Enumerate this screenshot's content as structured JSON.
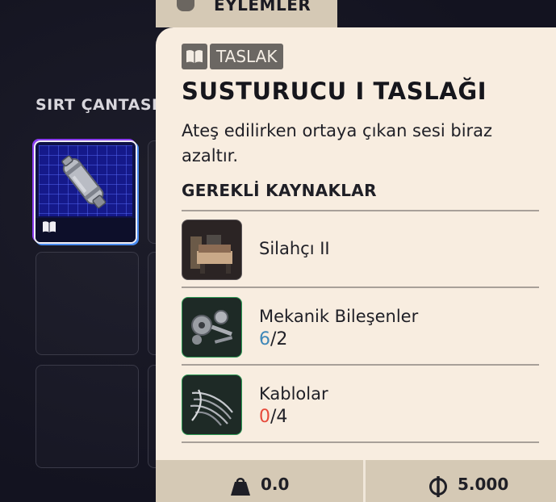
{
  "backpack": {
    "title": "SIRT ÇANTASI"
  },
  "actions_tab": {
    "label": "EYLEMLER"
  },
  "tooltip": {
    "badge_label": "TASLAK",
    "title": "SUSTURUCU I TASLAĞI",
    "description": "Ateş edilirken ortaya çıkan sesi biraz azaltır.",
    "requirements_title": "GEREKLİ KAYNAKLAR",
    "resources": [
      {
        "name": "Silahçı II",
        "icon": "workbench-icon"
      },
      {
        "name": "Mekanik Bileşenler",
        "have": "6",
        "need": "/2",
        "icon": "mechanical-parts-icon"
      },
      {
        "name": "Kablolar",
        "have": "0",
        "need": "/4",
        "icon": "wires-icon"
      }
    ]
  },
  "bottom_bar": {
    "weight": "0.0",
    "value": "5.000"
  },
  "colors": {
    "panel_bg": "#f8ede0",
    "bar_bg": "#d5c9b5",
    "ok": "#3e87b8",
    "insufficient": "#e64a3b"
  }
}
